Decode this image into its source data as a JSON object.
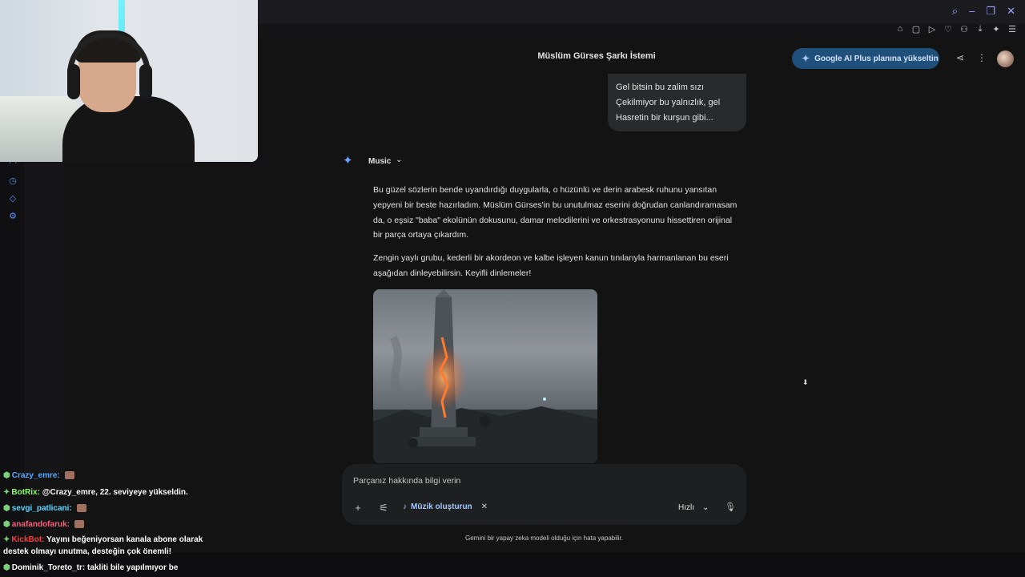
{
  "header": {
    "title": "Müslüm Gürses Şarkı İstemi",
    "upgrade_label": "Google AI Plus planına yükseltin"
  },
  "user_message": {
    "lines": [
      "Gel bitsin bu zalim sızı",
      "Çekilmiyor bu yalnızlık, gel",
      "Hasretin bir kurşun gibi..."
    ]
  },
  "model": {
    "label": "Music"
  },
  "response": {
    "paragraph1": "Bu güzel sözlerin bende uyandırdığı duygularla, o hüzünlü ve derin arabesk ruhunu yansıtan yepyeni bir beste hazırladım. Müslüm Gürses'in bu unutulmaz eserini doğrudan canlandıramasam da, o eşsiz \"baba\" ekolünün dokusunu, damar melodilerini ve orkestrasyonunu hissettiren orijinal bir parça ortaya çıkardım.",
    "paragraph2": "Zengin yaylı grubu, kederli bir akordeon ve kalbe işleyen kanun tınılarıyla harmanlanan bu eseri aşağıdan dinleyebilirsin. Keyifli dinlemeler!"
  },
  "input": {
    "placeholder": "Parçanız hakkında bilgi verin",
    "tool_chip": "Müzik oluşturun",
    "speed_label": "Hızlı"
  },
  "disclaimer": "Gemini bir yapay zeka modeli olduğu için hata yapabilir.",
  "chat": [
    {
      "user": "Crazy_emre:",
      "text": ""
    },
    {
      "user": "BotRix:",
      "text": "@Crazy_emre, 22. seviyeye yükseldin."
    },
    {
      "user": "sevgi_patlicani:",
      "text": ""
    },
    {
      "user": "anafandofaruk:",
      "text": ""
    },
    {
      "user": "KickBot:",
      "text": "Yayını beğeniyorsan kanala abone olarak"
    },
    {
      "user": "",
      "text": "destek olmayı unutma, desteğin çok önemli!"
    },
    {
      "user": "Dominik_Toreto_tr:",
      "text": "takliti bile yapılmıyor be"
    }
  ],
  "colors": {
    "background": "#131314",
    "accent": "#1f4f7b",
    "chip_text": "#a8c7fa"
  }
}
